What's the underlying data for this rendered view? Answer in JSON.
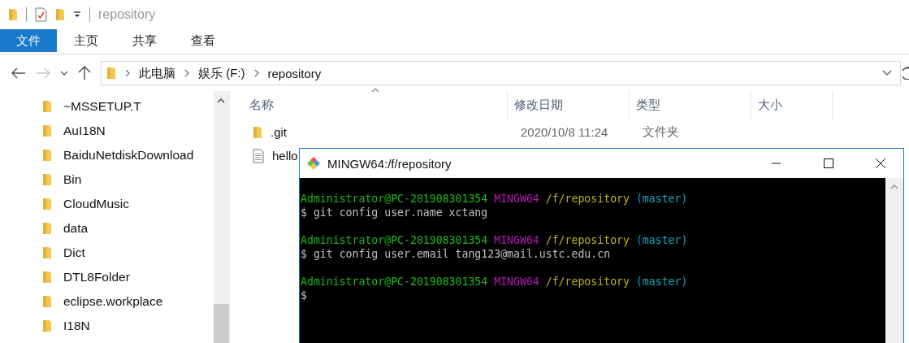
{
  "explorer": {
    "title": "repository",
    "ribbon_tabs": [
      {
        "label": "文件",
        "selected": true
      },
      {
        "label": "主页",
        "selected": false
      },
      {
        "label": "共享",
        "selected": false
      },
      {
        "label": "查看",
        "selected": false
      }
    ],
    "nav": {
      "back_disabled": false,
      "forward_disabled": true
    },
    "breadcrumbs": [
      "此电脑",
      "娱乐 (F:)",
      "repository"
    ],
    "sidebar": {
      "items": [
        "~MSSETUP.T",
        "AuI18N",
        "BaiduNetdiskDownload",
        "Bin",
        "CloudMusic",
        "data",
        "Dict",
        "DTL8Folder",
        "eclipse.workplace",
        "I18N"
      ]
    },
    "table": {
      "columns": [
        "名称",
        "修改日期",
        "类型",
        "大小"
      ],
      "rows": [
        {
          "kind": "folder",
          "name": ".git",
          "modified": "2020/10/8 11:24",
          "type": "文件夹"
        },
        {
          "kind": "file",
          "name": "hello"
        }
      ]
    }
  },
  "terminal": {
    "title": "MINGW64:/f/repository",
    "blocks": [
      {
        "user": "Administrator@PC-201908301354",
        "system": "MINGW64",
        "path": "/f/repository",
        "branch": "(master)",
        "command": "$ git config user.name xctang"
      },
      {
        "user": "Administrator@PC-201908301354",
        "system": "MINGW64",
        "path": "/f/repository",
        "branch": "(master)",
        "command": "$ git config user.email tang123@mail.ustc.edu.cn"
      },
      {
        "user": "Administrator@PC-201908301354",
        "system": "MINGW64",
        "path": "/f/repository",
        "branch": "(master)",
        "command": "$"
      }
    ]
  }
}
